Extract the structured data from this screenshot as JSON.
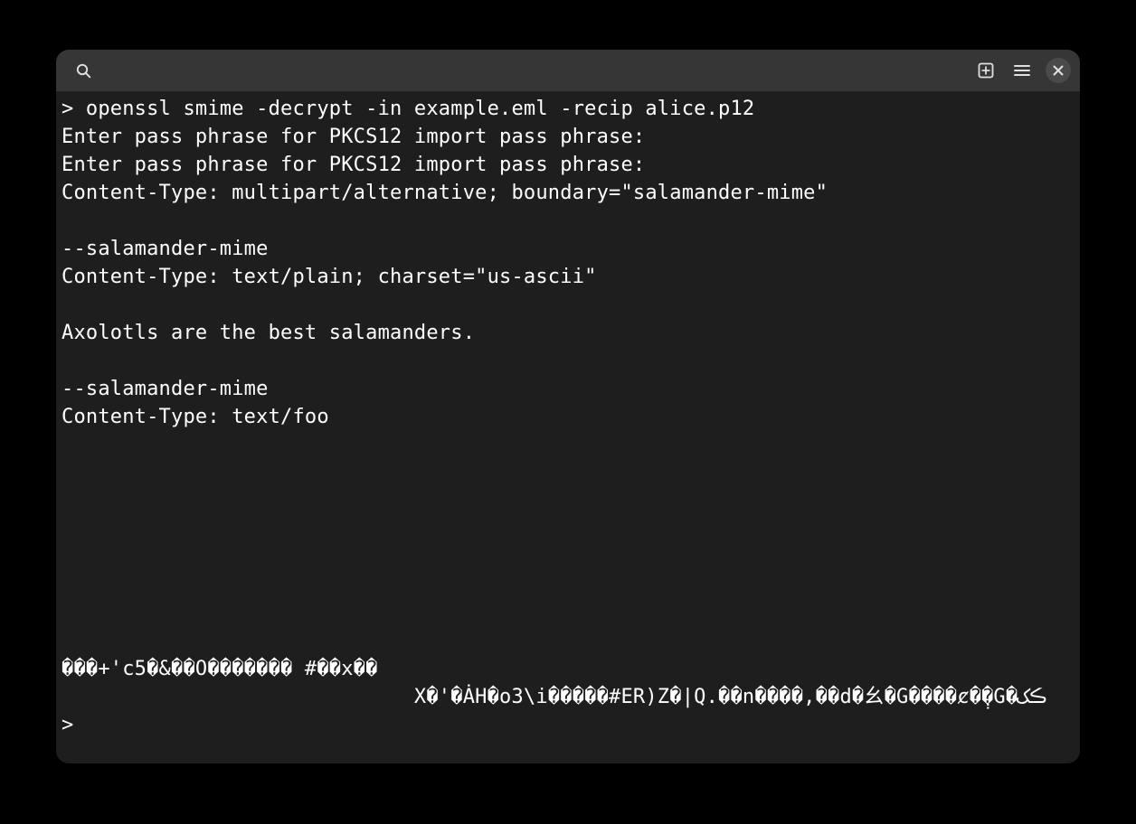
{
  "terminal": {
    "lines": [
      "> openssl smime -decrypt -in example.eml -recip alice.p12",
      "Enter pass phrase for PKCS12 import pass phrase:",
      "Enter pass phrase for PKCS12 import pass phrase:",
      "Content-Type: multipart/alternative; boundary=\"salamander-mime\"",
      "",
      "--salamander-mime",
      "Content-Type: text/plain; charset=\"us-ascii\"",
      "",
      "Axolotls are the best salamanders.",
      "",
      "--salamander-mime",
      "Content-Type: text/foo",
      "",
      "",
      "",
      "",
      "",
      "",
      "",
      "",
      "���+'c5�&��O������� #��x��",
      "                             X�'�ȦH�o3\\i�����#ER)Z�|Q.��n����,��d�⼳�G����ȼ�݄�G�ڪک",
      ">"
    ]
  },
  "icons": {
    "search": "search-icon",
    "new_tab": "new-tab-icon",
    "menu": "menu-icon",
    "close": "close-icon"
  }
}
